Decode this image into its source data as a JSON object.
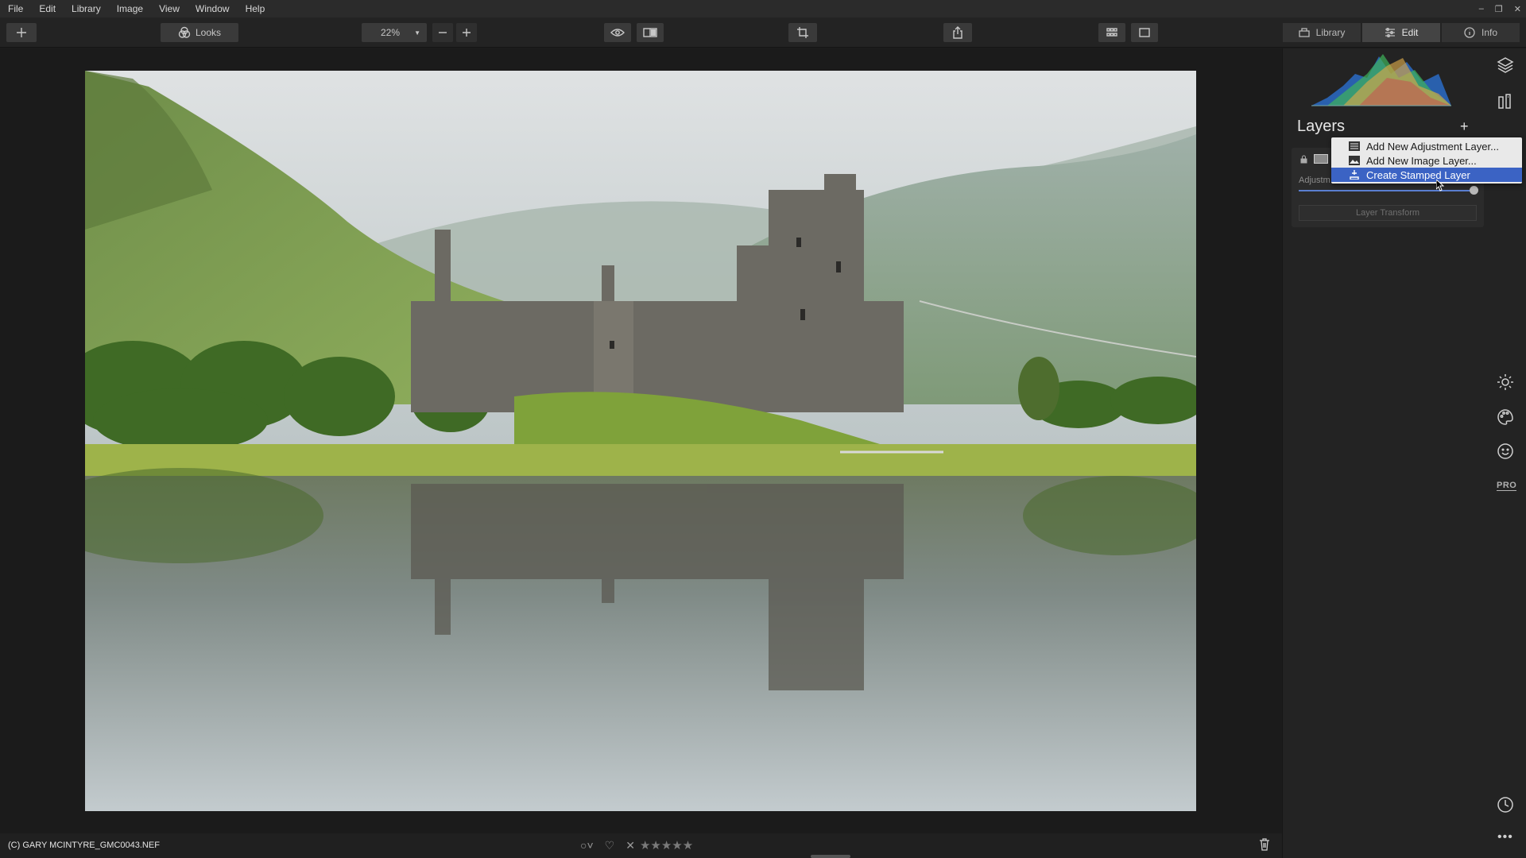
{
  "menu": [
    "File",
    "Edit",
    "Library",
    "Image",
    "View",
    "Window",
    "Help"
  ],
  "toolbar": {
    "looks_label": "Looks",
    "zoom_value": "22%"
  },
  "right_tabs": [
    {
      "label": "Library",
      "icon": "import-icon"
    },
    {
      "label": "Edit",
      "icon": "sliders-icon",
      "active": true
    },
    {
      "label": "Info",
      "icon": "info-icon"
    }
  ],
  "sidebar": {
    "title": "Layers",
    "layer": {
      "adjustment_label": "Adjustm",
      "transform_label": "Layer Transform",
      "amount_fraction": 1.0
    }
  },
  "context_menu": {
    "items": [
      {
        "label": "Add New Adjustment Layer...",
        "icon": "adjustment-layer-icon"
      },
      {
        "label": "Add New Image Layer...",
        "icon": "image-layer-icon"
      },
      {
        "label": "Create Stamped Layer",
        "icon": "stamp-icon",
        "highlighted": true
      }
    ]
  },
  "status": {
    "filename": "(C) GARY MCINTYRE_GMC0043.NEF",
    "stars": "★★★★★"
  },
  "colors": {
    "accent": "#3b63c4",
    "panel_bg": "#232323",
    "canvas_bg": "#1b1b1b"
  }
}
